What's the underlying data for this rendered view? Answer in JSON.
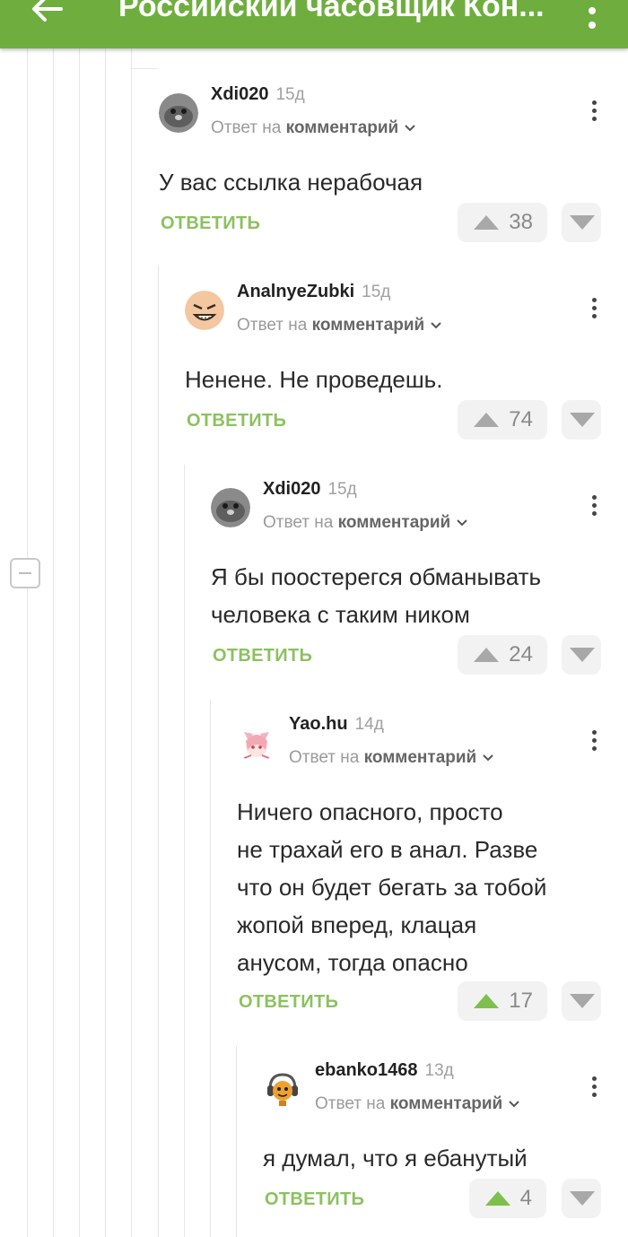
{
  "header": {
    "title": "Российский часовщик Кон...",
    "back_icon": "arrow-left-icon",
    "menu_icon": "more-vertical-icon",
    "bg_color": "#6fae3e"
  },
  "colors": {
    "reply_button": "#8cc160",
    "upvote_active": "#7fbf4d",
    "vote_inactive": "#a8a8a8"
  },
  "comments": [
    {
      "username": "Xdi020",
      "age": "15д",
      "reply_prefix": "Ответ на",
      "reply_target": "комментарий",
      "text": "У вас ссылка нерабочая",
      "reply_label": "ОТВЕТИТЬ",
      "votes": "38",
      "upvoted": false
    },
    {
      "username": "AnalnyeZubki",
      "age": "15д",
      "reply_prefix": "Ответ на",
      "reply_target": "комментарий",
      "text": "Ненене. Не проведешь.",
      "reply_label": "ОТВЕТИТЬ",
      "votes": "74",
      "upvoted": false
    },
    {
      "username": "Xdi020",
      "age": "15д",
      "reply_prefix": "Ответ на",
      "reply_target": "комментарий",
      "text": "Я бы поостерегся обманывать\nчеловека с таким ником",
      "reply_label": "ОТВЕТИТЬ",
      "votes": "24",
      "upvoted": false
    },
    {
      "username": "Yao.hu",
      "age": "14д",
      "reply_prefix": "Ответ на",
      "reply_target": "комментарий",
      "text": "Ничего опасного, просто\nне трахай его в анал. Разве\nчто он будет бегать за тобой\nжопой вперед, клацая\nанусом, тогда опасно",
      "reply_label": "ОТВЕТИТЬ",
      "votes": "17",
      "upvoted": true
    },
    {
      "username": "ebanko1468",
      "age": "13д",
      "reply_prefix": "Ответ на",
      "reply_target": "комментарий",
      "text": "я думал, что я ебанутый",
      "reply_label": "ОТВЕТИТЬ",
      "votes": "4",
      "upvoted": true
    }
  ]
}
